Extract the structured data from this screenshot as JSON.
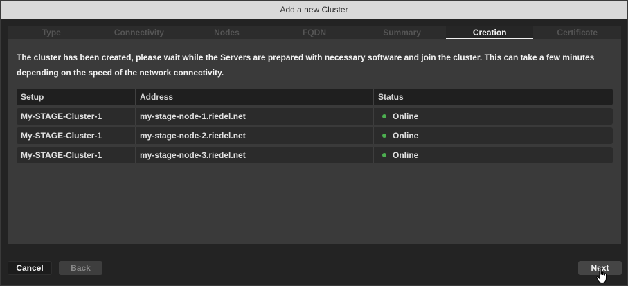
{
  "window": {
    "title": "Add a new Cluster"
  },
  "tabs": [
    {
      "label": "Type",
      "active": false
    },
    {
      "label": "Connectivity",
      "active": false
    },
    {
      "label": "Nodes",
      "active": false
    },
    {
      "label": "FQDN",
      "active": false
    },
    {
      "label": "Summary",
      "active": false
    },
    {
      "label": "Creation",
      "active": true
    },
    {
      "label": "Certificate",
      "active": false
    }
  ],
  "message": "The cluster has been created, please wait while the Servers are prepared with necessary software and join the cluster. This can take a few minutes depending on the speed of the network connectivity.",
  "table": {
    "headers": {
      "setup": "Setup",
      "address": "Address",
      "status": "Status"
    },
    "rows": [
      {
        "setup": "My-STAGE-Cluster-1",
        "address": "my-stage-node-1.riedel.net",
        "status": "Online"
      },
      {
        "setup": "My-STAGE-Cluster-1",
        "address": "my-stage-node-2.riedel.net",
        "status": "Online"
      },
      {
        "setup": "My-STAGE-Cluster-1",
        "address": "my-stage-node-3.riedel.net",
        "status": "Online"
      }
    ],
    "status_color": "#4caf50"
  },
  "buttons": {
    "cancel": "Cancel",
    "back": "Back",
    "next": "Next"
  },
  "cursor": {
    "icon": "hand-pointer-icon"
  }
}
